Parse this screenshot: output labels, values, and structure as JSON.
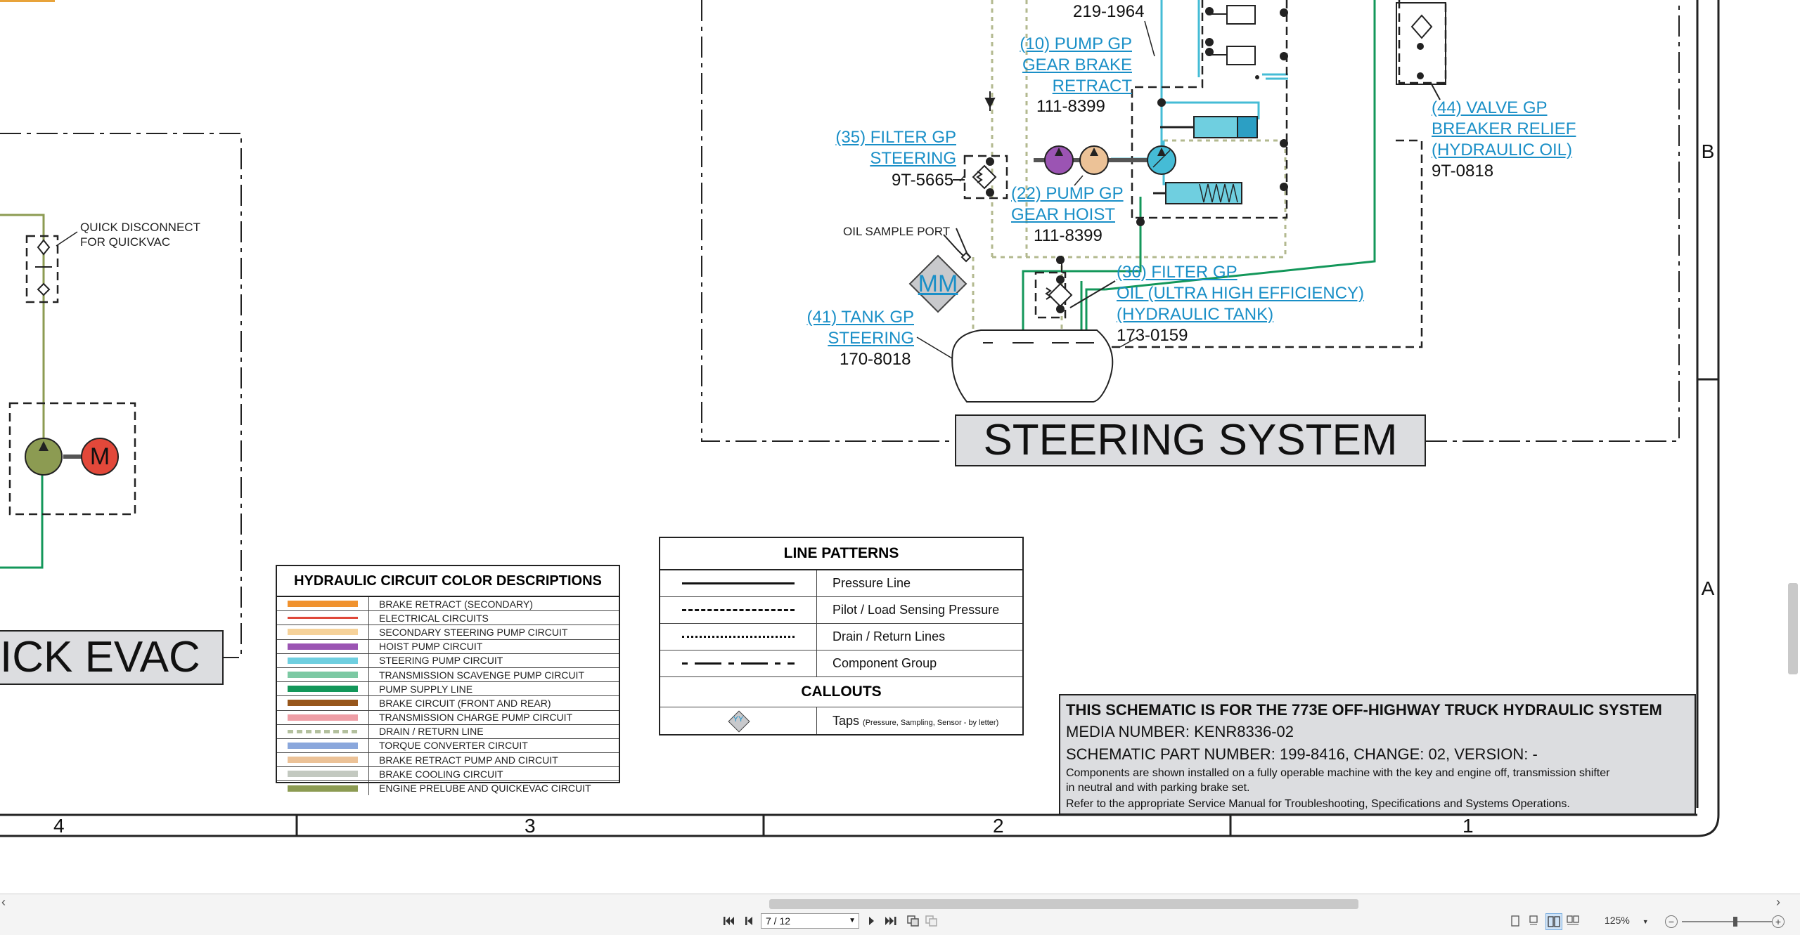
{
  "callouts": {
    "part_219": "219-1964",
    "pump10_link": [
      "(10) PUMP GP",
      "GEAR BRAKE",
      "RETRACT"
    ],
    "pump10_part": "111-8399",
    "filter35_link": [
      "(35) FILTER GP",
      "STEERING"
    ],
    "filter35_part": "9T-5665",
    "pump22_link": [
      "(22) PUMP GP",
      "GEAR HOIST"
    ],
    "pump22_part": "111-8399",
    "valve44_link": [
      "(44) VALVE GP",
      "BREAKER RELIEF",
      "(HYDRAULIC OIL)"
    ],
    "valve44_part": "9T-0818",
    "oil_sample": "OIL SAMPLE PORT",
    "mm_tap": "MM",
    "filter36_link": [
      "(36) FILTER GP",
      "OIL (ULTRA HIGH EFFICIENCY)",
      "(HYDRAULIC TANK)"
    ],
    "filter36_part": "173-0159",
    "tank41_link": [
      "(41) TANK GP",
      "STEERING"
    ],
    "tank41_part": "170-8018",
    "quick_disconnect": [
      "QUICK DISCONNECT",
      "FOR QUICKVAC"
    ],
    "motor_label": "M"
  },
  "section_titles": {
    "steering": "STEERING SYSTEM",
    "quick_evac": "ICK EVAC"
  },
  "zone_labels": {
    "right_b": "B",
    "right_a": "A",
    "bottom": [
      "4",
      "3",
      "2",
      "1"
    ]
  },
  "color_legend": {
    "title": "HYDRAULIC CIRCUIT COLOR DESCRIPTIONS",
    "items": [
      {
        "label": "BRAKE RETRACT (SECONDARY)",
        "color": "#f0922e",
        "style": "solid"
      },
      {
        "label": "ELECTRICAL CIRCUITS",
        "color": "#e0483a",
        "style": "thin"
      },
      {
        "label": "SECONDARY STEERING PUMP CIRCUIT",
        "color": "#f6d29a",
        "style": "solid"
      },
      {
        "label": "HOIST PUMP CIRCUIT",
        "color": "#9b54b3",
        "style": "solid"
      },
      {
        "label": "STEERING PUMP CIRCUIT",
        "color": "#6fcfe0",
        "style": "solid"
      },
      {
        "label": "TRANSMISSION SCAVENGE PUMP CIRCUIT",
        "color": "#7cc9a3",
        "style": "solid"
      },
      {
        "label": "PUMP SUPPLY LINE",
        "color": "#13975a",
        "style": "solid"
      },
      {
        "label": "BRAKE CIRCUIT (FRONT AND REAR)",
        "color": "#97561b",
        "style": "solid"
      },
      {
        "label": "TRANSMISSION CHARGE PUMP CIRCUIT",
        "color": "#ee9ea6",
        "style": "solid"
      },
      {
        "label": "DRAIN / RETURN LINE",
        "color": "#b3c09e",
        "style": "dotted"
      },
      {
        "label": "TORQUE CONVERTER CIRCUIT",
        "color": "#8aa7dc",
        "style": "solid"
      },
      {
        "label": "BRAKE RETRACT PUMP AND CIRCUIT",
        "color": "#ecc297",
        "style": "solid"
      },
      {
        "label": "BRAKE COOLING CIRCUIT",
        "color": "#c3c9c0",
        "style": "solid"
      },
      {
        "label": "ENGINE PRELUBE AND QUICKEVAC CIRCUIT",
        "color": "#8c9b52",
        "style": "solid"
      }
    ]
  },
  "line_patterns": {
    "title": "LINE PATTERNS",
    "items": [
      {
        "label": "Pressure Line",
        "pattern": "solid"
      },
      {
        "label": "Pilot / Load Sensing Pressure",
        "pattern": "dashed"
      },
      {
        "label": "Drain / Return Lines",
        "pattern": "dotted"
      },
      {
        "label": "Component Group",
        "pattern": "dashdot"
      }
    ],
    "callouts_title": "CALLOUTS",
    "tap_symbol": "YY",
    "tap_label": "Taps",
    "tap_note": "(Pressure, Sampling, Sensor - by letter)"
  },
  "title_block": {
    "line1": "THIS SCHEMATIC IS FOR THE 773E OFF-HIGHWAY TRUCK HYDRAULIC SYSTEM",
    "line2": "MEDIA NUMBER: KENR8336-02",
    "line3": "SCHEMATIC PART NUMBER: 199-8416, CHANGE: 02, VERSION: -",
    "line4": "Components are shown installed on a fully operable machine with the key and engine off, transmission shifter",
    "line5": "in neutral and with parking brake set.",
    "line6": "Refer to the appropriate Service Manual for Troubleshooting, Specifications and Systems Operations."
  },
  "toolbar": {
    "page_value": "7 / 12",
    "zoom": "125%",
    "first_icon": "first-page-icon",
    "prev_icon": "prev-page-icon",
    "next_icon": "next-page-icon",
    "last_icon": "last-page-icon",
    "scroll_left_glyph": "‹",
    "scroll_right_glyph": "›",
    "zoom_out_glyph": "−",
    "zoom_in_glyph": "+",
    "zoom_slider_level": 0.6
  }
}
